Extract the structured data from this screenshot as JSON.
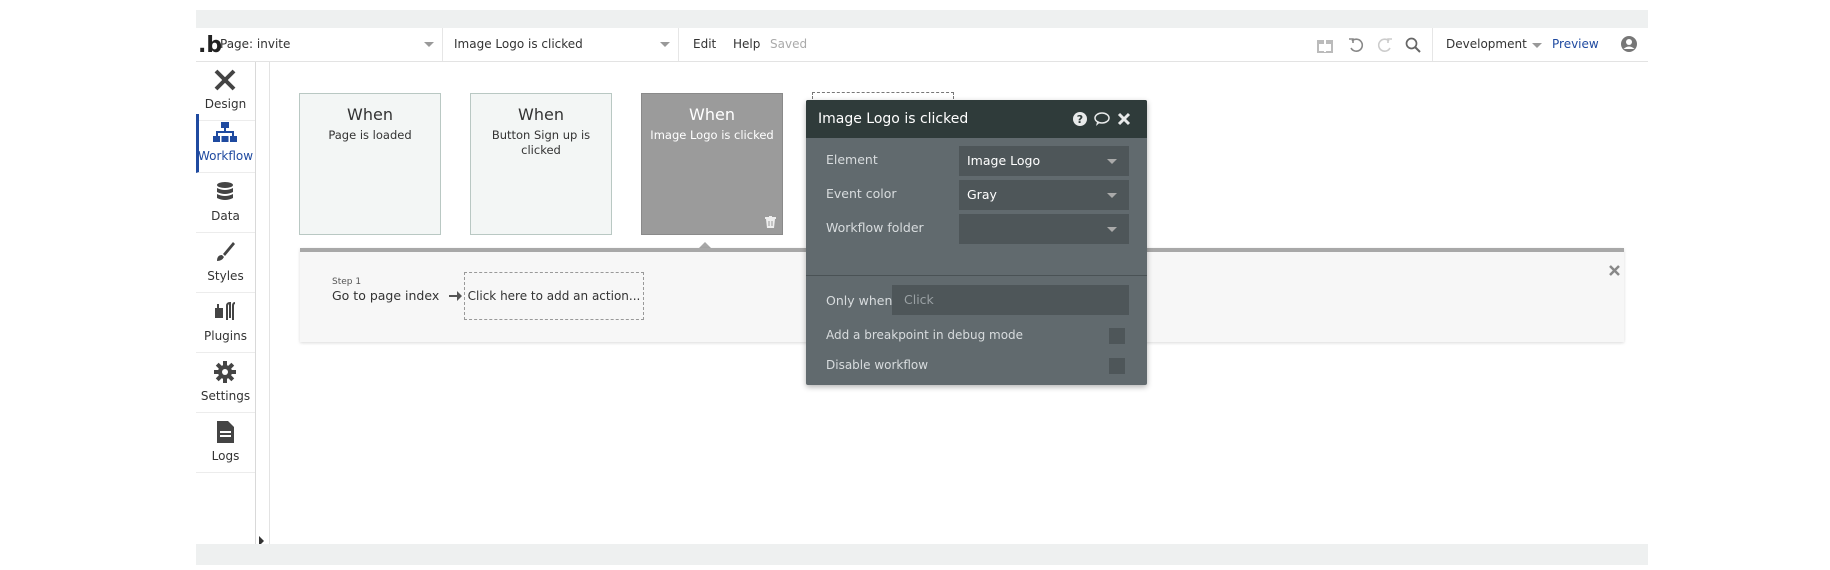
{
  "app": {
    "logo": ".b"
  },
  "header": {
    "page_selector": "Page: invite",
    "event_selector": "Image Logo is clicked",
    "edit": "Edit",
    "help": "Help",
    "saved": "Saved",
    "environment": "Development",
    "preview": "Preview"
  },
  "sidebar": {
    "items": [
      {
        "label": "Design",
        "icon": "design-icon"
      },
      {
        "label": "Workflow",
        "icon": "workflow-icon"
      },
      {
        "label": "Data",
        "icon": "database-icon"
      },
      {
        "label": "Styles",
        "icon": "brush-icon"
      },
      {
        "label": "Plugins",
        "icon": "plugins-icon"
      },
      {
        "label": "Settings",
        "icon": "gear-icon"
      },
      {
        "label": "Logs",
        "icon": "document-icon"
      }
    ],
    "active": "Workflow"
  },
  "events": [
    {
      "when": "When",
      "desc": "Page is loaded"
    },
    {
      "when": "When",
      "desc": "Button Sign up is clicked"
    },
    {
      "when": "When",
      "desc": "Image Logo is clicked"
    }
  ],
  "actions": {
    "step_label": "Step 1",
    "step_text": "Go to page index",
    "add_action": "Click here to add an action..."
  },
  "panel": {
    "title": "Image Logo is clicked",
    "element_label": "Element",
    "element_value": "Image Logo",
    "event_color_label": "Event color",
    "event_color_value": "Gray",
    "workflow_folder_label": "Workflow folder",
    "workflow_folder_value": "",
    "only_when_label": "Only when",
    "only_when_placeholder": "Click",
    "breakpoint_label": "Add a breakpoint in debug mode",
    "disable_label": "Disable workflow"
  },
  "colors": {
    "accent": "#1f4aa0",
    "panel_bg": "#616a6e",
    "panel_header": "#2f3b3a",
    "selected_event": "#9b9b9b"
  }
}
